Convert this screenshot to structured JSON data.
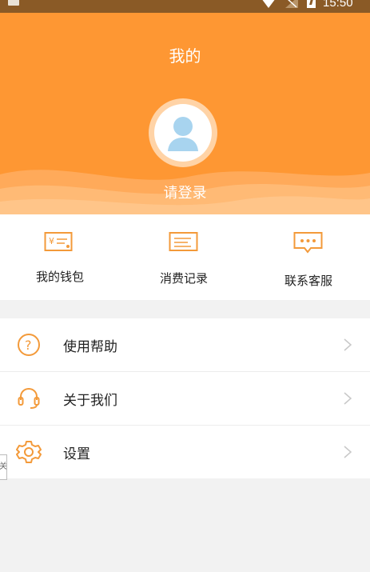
{
  "status_bar": {
    "time": "15:50"
  },
  "header": {
    "title": "我的",
    "login_prompt": "请登录",
    "colors": {
      "primary": "#fe9733",
      "accent_icon": "#f39a3a",
      "avatar_blue": "#a8d4ef"
    }
  },
  "quick_actions": [
    {
      "label": "我的钱包",
      "icon": "wallet-icon"
    },
    {
      "label": "消费记录",
      "icon": "receipt-list-icon"
    },
    {
      "label": "联系客服",
      "icon": "chat-bubble-icon"
    }
  ],
  "menu": [
    {
      "label": "使用帮助",
      "icon": "help-circle-icon"
    },
    {
      "label": "关于我们",
      "icon": "headset-icon"
    },
    {
      "label": "设置",
      "icon": "gear-icon"
    }
  ],
  "edge_tab_text": "关"
}
